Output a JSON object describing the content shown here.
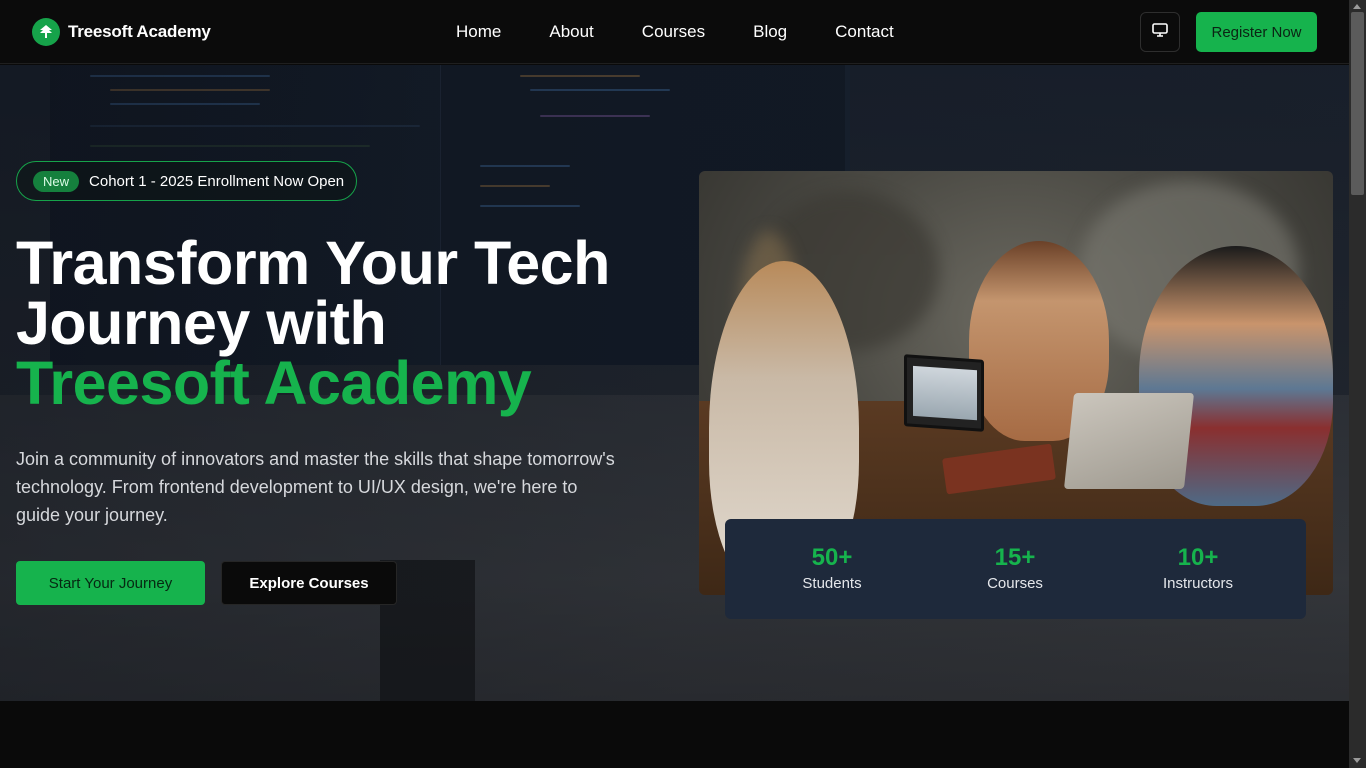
{
  "nav": {
    "brand": "Treesoft Academy",
    "links": [
      "Home",
      "About",
      "Courses",
      "Blog",
      "Contact"
    ],
    "register_label": "Register Now"
  },
  "hero": {
    "badge_pill": "New",
    "badge_text": "Cohort 1 - 2025 Enrollment Now Open",
    "headline_line1": "Transform Your Tech",
    "headline_line2": "Journey with",
    "headline_highlight": "Treesoft Academy",
    "description": "Join a community of innovators and master the skills that shape tomorrow's technology. From frontend development to UI/UX design, we're here to guide your journey.",
    "primary_cta": "Start Your Journey",
    "secondary_cta": "Explore Courses"
  },
  "stats": [
    {
      "value": "50+",
      "label": "Students"
    },
    {
      "value": "15+",
      "label": "Courses"
    },
    {
      "value": "10+",
      "label": "Instructors"
    }
  ],
  "colors": {
    "accent": "#16b34d",
    "background": "#0a0a0a",
    "stats_card": "#1e293b"
  },
  "icons": {
    "brand": "tree-logo-icon",
    "theme_toggle": "monitor-icon"
  }
}
